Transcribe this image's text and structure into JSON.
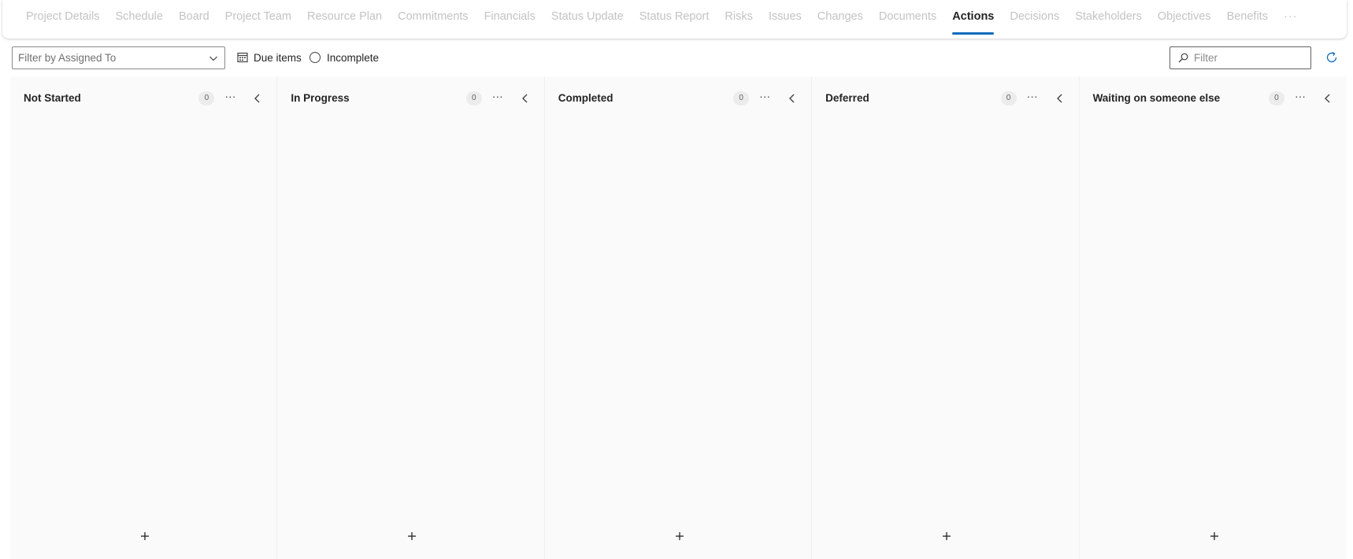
{
  "tabs": [
    {
      "label": "Project Details",
      "active": false
    },
    {
      "label": "Schedule",
      "active": false
    },
    {
      "label": "Board",
      "active": false
    },
    {
      "label": "Project Team",
      "active": false
    },
    {
      "label": "Resource Plan",
      "active": false
    },
    {
      "label": "Commitments",
      "active": false
    },
    {
      "label": "Financials",
      "active": false
    },
    {
      "label": "Status Update",
      "active": false
    },
    {
      "label": "Status Report",
      "active": false
    },
    {
      "label": "Risks",
      "active": false
    },
    {
      "label": "Issues",
      "active": false
    },
    {
      "label": "Changes",
      "active": false
    },
    {
      "label": "Documents",
      "active": false
    },
    {
      "label": "Actions",
      "active": true
    },
    {
      "label": "Decisions",
      "active": false
    },
    {
      "label": "Stakeholders",
      "active": false
    },
    {
      "label": "Objectives",
      "active": false
    },
    {
      "label": "Benefits",
      "active": false
    }
  ],
  "tabs_more": "···",
  "toolbar": {
    "assigned_placeholder": "Filter by Assigned To",
    "due_items_label": "Due items",
    "incomplete_label": "Incomplete",
    "filter_placeholder": "Filter"
  },
  "columns": [
    {
      "title": "Not Started",
      "count": "0"
    },
    {
      "title": "In Progress",
      "count": "0"
    },
    {
      "title": "Completed",
      "count": "0"
    },
    {
      "title": "Deferred",
      "count": "0"
    },
    {
      "title": "Waiting on someone else",
      "count": "0"
    }
  ],
  "column_more_glyph": "···",
  "colors": {
    "accent": "#0f6cbd",
    "inactive_tab": "#c3c3c3",
    "column_bg": "#fafafa"
  },
  "icons": {
    "assigned_dropdown": "chevron-down-icon",
    "due_items": "calendar-icon",
    "incomplete": "radio-circle-icon",
    "filter": "search-icon",
    "refresh": "refresh-icon",
    "column_more": "more-horizontal-icon",
    "column_collapse": "chevron-left-icon",
    "column_add": "plus-icon"
  }
}
